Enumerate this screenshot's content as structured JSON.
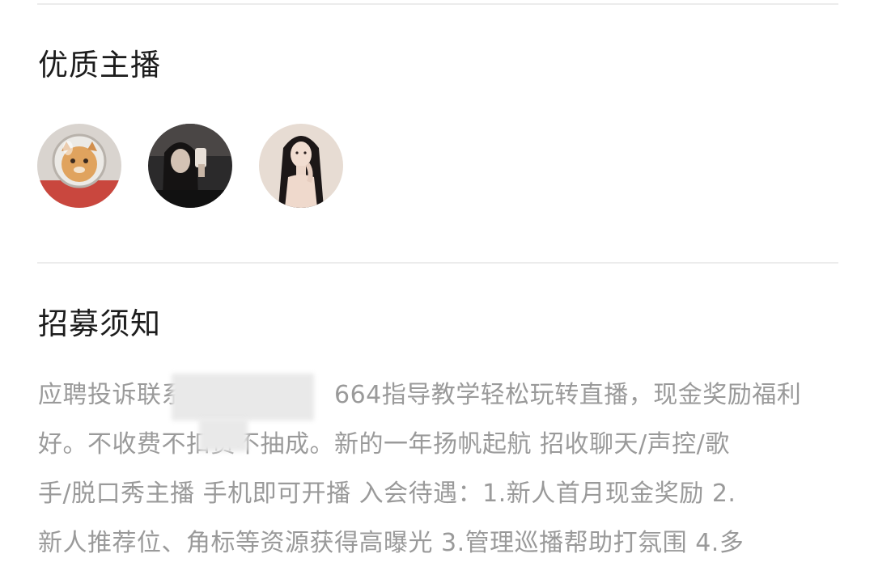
{
  "anchors_section": {
    "title": "优质主播",
    "avatars": [
      {
        "icon": "astronaut-cat-avatar"
      },
      {
        "icon": "dark-selfie-avatar"
      },
      {
        "icon": "long-hair-portrait-avatar"
      }
    ]
  },
  "notice_section": {
    "title": "招募须知",
    "lines": [
      "应聘投诉联系　　　　　　664指导教学轻松玩转直播，现金奖励福利",
      "好。不收费不扣费不抽成。新的一年扬帆起航 招收聊天/声控/歌",
      "手/脱口秀主播 手机即可开播 入会待遇：1.新人首月现金奖励 2.",
      "新人推荐位、角标等资源获得高曝光 3.管理巡播帮助打氛围 4.多"
    ]
  },
  "colors": {
    "title_text": "#1c1c1c",
    "body_text": "#9a9a9a",
    "divider": "#ececec"
  }
}
